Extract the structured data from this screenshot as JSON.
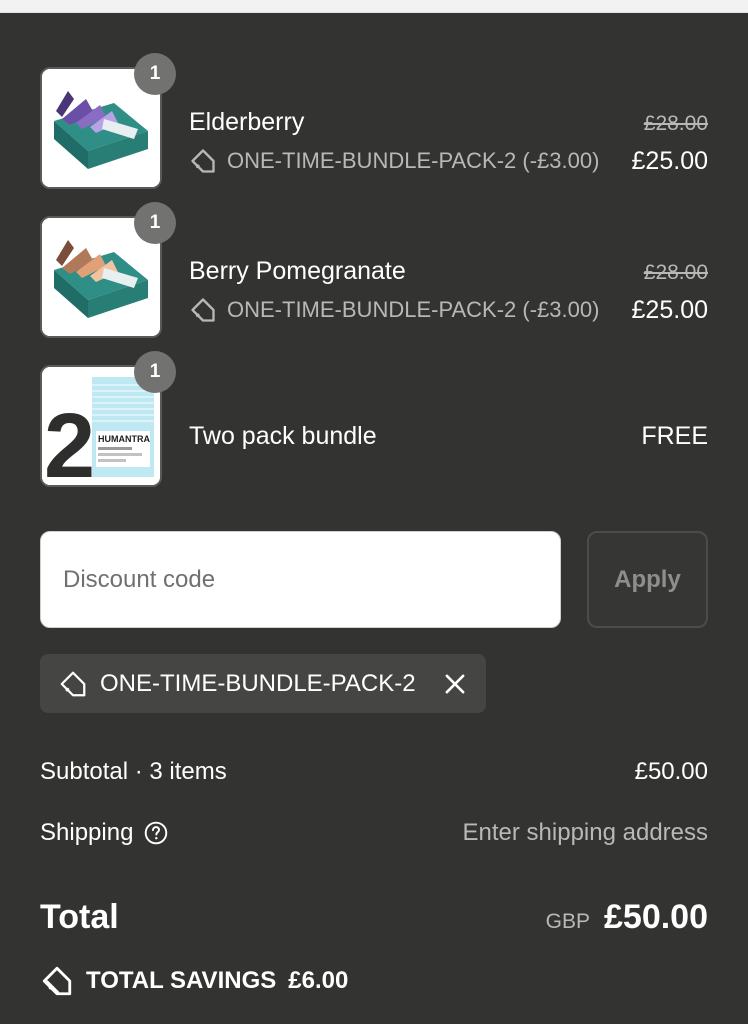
{
  "items": [
    {
      "name": "Elderberry",
      "quantity": "1",
      "discount_text": "ONE-TIME-BUNDLE-PACK-2 (-£3.00)",
      "original_price": "£28.00",
      "price": "£25.00",
      "image_icon": "product-box-purple-image"
    },
    {
      "name": "Berry Pomegranate",
      "quantity": "1",
      "discount_text": "ONE-TIME-BUNDLE-PACK-2 (-£3.00)",
      "original_price": "£28.00",
      "price": "£25.00",
      "image_icon": "product-box-peach-image"
    },
    {
      "name": "Two pack bundle",
      "quantity": "1",
      "price": "FREE",
      "image_icon": "two-pack-bundle-image",
      "image_brand": "HUMANTRA",
      "image_number": "2"
    }
  ],
  "discount": {
    "placeholder": "Discount code",
    "apply_label": "Apply",
    "applied_code": "ONE-TIME-BUNDLE-PACK-2"
  },
  "summary": {
    "subtotal_label": "Subtotal · 3 items",
    "subtotal_value": "£50.00",
    "shipping_label": "Shipping",
    "shipping_value": "Enter shipping address",
    "total_label": "Total",
    "currency": "GBP",
    "total_value": "£50.00",
    "savings_label": "TOTAL SAVINGS",
    "savings_value": "£6.00"
  },
  "colors": {
    "panel_background": "#333432",
    "badge": "#727370",
    "muted_text": "#b8b9b6"
  }
}
